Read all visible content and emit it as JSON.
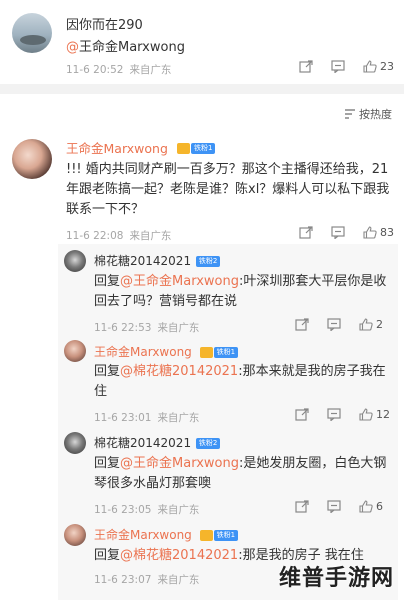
{
  "top_comment": {
    "username": "因你而在290",
    "reply_prefix": "@",
    "reply_mention": "王命金Marxwong",
    "time": "11-6 20:52",
    "source": "来自广东",
    "likes": "23"
  },
  "sort": {
    "label": "按热度"
  },
  "main_comment": {
    "username": "王命金Marxwong",
    "fans_badge": "铁粉1",
    "text": "!!! 婚内共同财产刷一百多万？那这个主播得还给我，21年跟老陈搞一起？老陈是谁？陈xl？爆料人可以私下跟我联系一下不？",
    "time": "11-6 22:08",
    "source": "来自广东",
    "likes": "83"
  },
  "replies": [
    {
      "username": "棉花糖20142021",
      "fans_badge": "铁粉2",
      "reply_word": "回复",
      "mention": "@王命金Marxwong",
      "text": ":叶深圳那套大平层你是收回去了吗？营销号都在说",
      "time": "11-6 22:53",
      "source": "来自广东",
      "likes": "2"
    },
    {
      "username": "王命金Marxwong",
      "fans_badge": "铁粉1",
      "reply_word": "回复",
      "mention": "@棉花糖20142021",
      "text": ":那本来就是我的房子我在住",
      "time": "11-6 23:01",
      "source": "来自广东",
      "likes": "12"
    },
    {
      "username": "棉花糖20142021",
      "fans_badge": "铁粉2",
      "reply_word": "回复",
      "mention": "@王命金Marxwong",
      "text": ":是她发朋友圈，白色大钢琴很多水晶灯那套噢",
      "time": "11-6 23:05",
      "source": "来自广东",
      "likes": "6"
    },
    {
      "username": "王命金Marxwong",
      "fans_badge": "铁粉1",
      "reply_word": "回复",
      "mention": "@棉花糖20142021",
      "text": ":那是我的房子 我在住",
      "time": "11-6 23:07",
      "source": "来自广东",
      "likes": ""
    }
  ],
  "watermark": "维普手游网",
  "icons": {
    "share": "share-icon",
    "comment": "comment-icon",
    "like": "thumbs-up-icon",
    "sort": "sort-icon"
  },
  "colors": {
    "mention": "#eb7350",
    "fans_badge": "#3e93f5",
    "crown": "#f5b52b",
    "meta": "#a6a6a6",
    "sub_bg": "#f7f7f7"
  }
}
